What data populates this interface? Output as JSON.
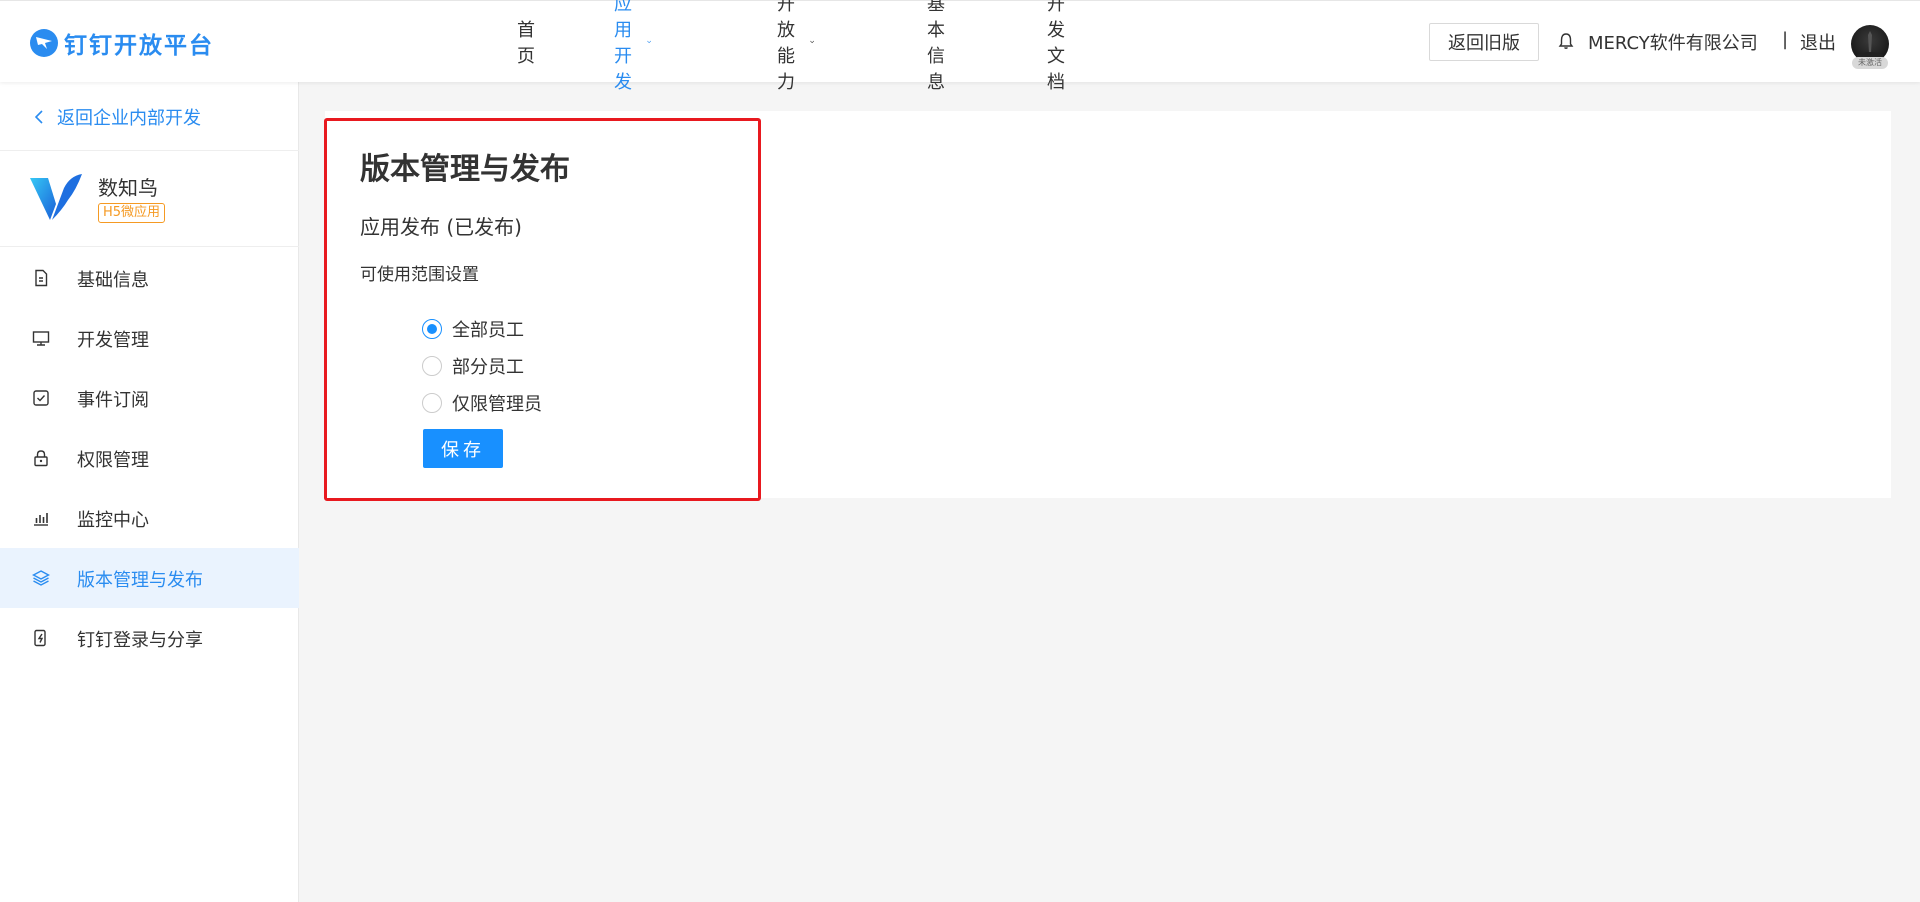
{
  "header": {
    "logo_text": "钉钉开放平台",
    "nav": [
      {
        "label": "首页",
        "active": false,
        "dropdown": false
      },
      {
        "label": "应用开发",
        "active": true,
        "dropdown": true
      },
      {
        "label": "开放能力",
        "active": false,
        "dropdown": true
      },
      {
        "label": "基本信息",
        "active": false,
        "dropdown": false
      },
      {
        "label": "开发文档",
        "active": false,
        "dropdown": false
      }
    ],
    "old_version_label": "返回旧版",
    "company_name": "MERCY软件有限公司",
    "separator": "|",
    "logout_label": "退出",
    "avatar_tag": "未激活"
  },
  "sidebar": {
    "back_label": "返回企业内部开发",
    "app_name": "数知鸟",
    "app_badge": "H5微应用",
    "items": [
      {
        "label": "基础信息",
        "icon": "document-icon",
        "active": false
      },
      {
        "label": "开发管理",
        "icon": "monitor-icon",
        "active": false
      },
      {
        "label": "事件订阅",
        "icon": "event-check-icon",
        "active": false
      },
      {
        "label": "权限管理",
        "icon": "lock-icon",
        "active": false
      },
      {
        "label": "监控中心",
        "icon": "bar-chart-icon",
        "active": false
      },
      {
        "label": "版本管理与发布",
        "icon": "layers-icon",
        "active": true
      },
      {
        "label": "钉钉登录与分享",
        "icon": "phone-share-icon",
        "active": false
      }
    ]
  },
  "main": {
    "title": "版本管理与发布",
    "subtitle": "应用发布 (已发布)",
    "scope_label": "可使用范围设置",
    "radio_options": [
      {
        "label": "全部员工",
        "checked": true
      },
      {
        "label": "部分员工",
        "checked": false
      },
      {
        "label": "仅限管理员",
        "checked": false
      }
    ],
    "save_label": "保存"
  },
  "colors": {
    "accent": "#2a8cf0",
    "primary_button": "#1890ff",
    "badge": "#f59a23",
    "highlight_border": "#e8191f",
    "active_menu_bg": "#eaf3fe"
  }
}
